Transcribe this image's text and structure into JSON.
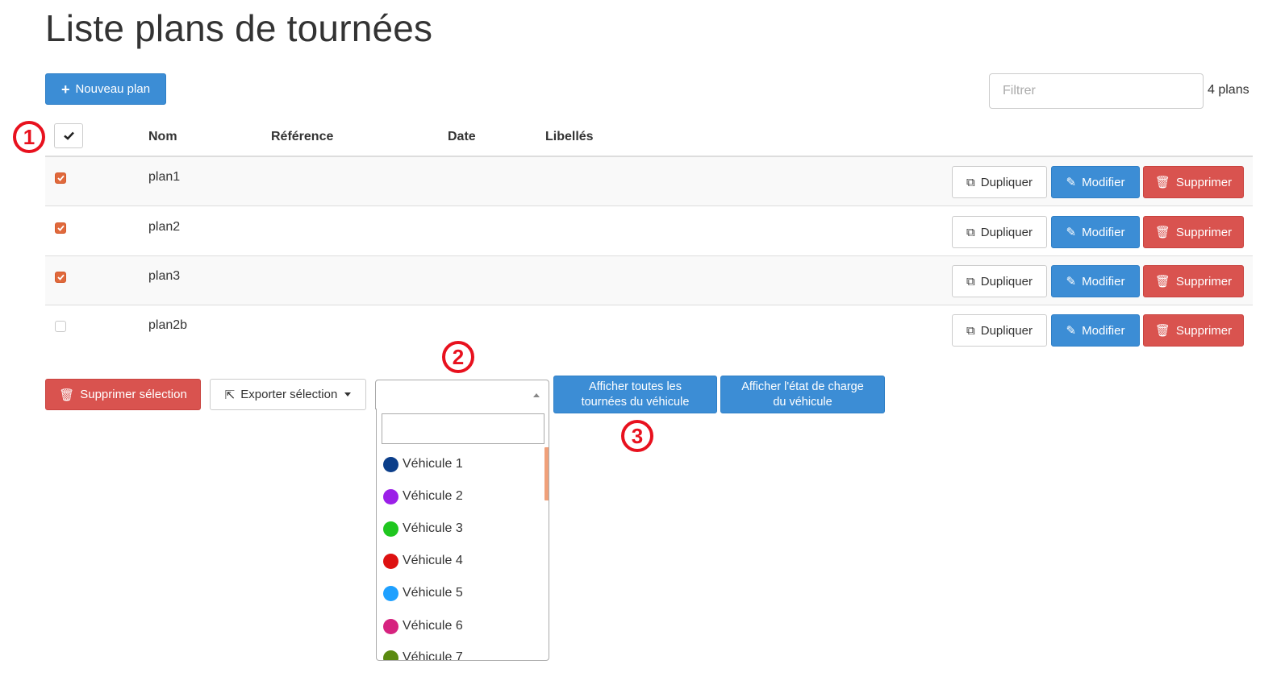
{
  "page_title": "Liste plans de tournées",
  "toolbar": {
    "new_plan_label": "Nouveau plan",
    "filter_placeholder": "Filtrer",
    "plan_count": "4 plans"
  },
  "annotations": [
    "1",
    "2",
    "3"
  ],
  "table": {
    "headers": [
      "Nom",
      "Référence",
      "Date",
      "Libellés"
    ],
    "rows": [
      {
        "name": "plan1",
        "checked": true
      },
      {
        "name": "plan2",
        "checked": true
      },
      {
        "name": "plan3",
        "checked": true
      },
      {
        "name": "plan2b",
        "checked": false
      }
    ],
    "actions": {
      "duplicate_label": "Dupliquer",
      "edit_label": "Modifier",
      "delete_label": "Supprimer"
    }
  },
  "bulk": {
    "delete_selection_label": "Supprimer sélection",
    "export_selection_label": "Exporter sélection",
    "show_all_tours_line1": "Afficher toutes les",
    "show_all_tours_line2": "tournées du véhicule",
    "show_charge_line1": "Afficher l'état de charge",
    "show_charge_line2": "du véhicule"
  },
  "vehicle_dropdown": {
    "search_value": "",
    "options": [
      {
        "label": "Véhicule 1",
        "color": "#0b3e8a"
      },
      {
        "label": "Véhicule 2",
        "color": "#9b1fe8"
      },
      {
        "label": "Véhicule 3",
        "color": "#1fc61f"
      },
      {
        "label": "Véhicule 4",
        "color": "#dd1111"
      },
      {
        "label": "Véhicule 5",
        "color": "#1ea0ff"
      },
      {
        "label": "Véhicule 6",
        "color": "#d6237f"
      },
      {
        "label": "Véhicule 7",
        "color": "#5a8a10"
      }
    ]
  },
  "colors": {
    "primary": "#3c8dd5",
    "danger": "#d9534f",
    "checkbox_checked": "#e0693c",
    "annotation_red": "#e8111e"
  }
}
